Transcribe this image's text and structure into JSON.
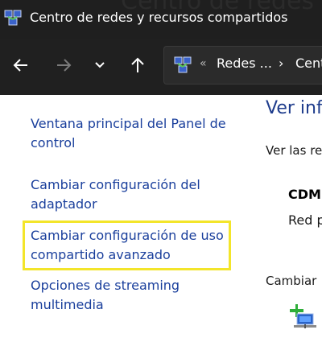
{
  "window": {
    "title": "Centro de redes y recursos compartidos",
    "background_title": "Centro de redes y"
  },
  "nav": {
    "back_icon": "arrow-left-icon",
    "forward_icon": "arrow-right-icon",
    "recent_icon": "chevron-down-icon",
    "up_icon": "arrow-up-icon"
  },
  "address": {
    "overflow": "«",
    "crumbs": [
      "Redes ...",
      "Cent"
    ],
    "separator": "›"
  },
  "sidebar": {
    "links": [
      "Ventana principal del Panel de control",
      "Cambiar configuración del adaptador",
      "Cambiar configuración de uso compartido avanzado",
      "Opciones de streaming multimedia"
    ]
  },
  "main": {
    "heading": "Ver info",
    "subheading": "Ver las re",
    "network_name": "CDM",
    "network_type": "Red p",
    "change_label": "Cambiar"
  },
  "colors": {
    "titlebar": "#1f1f1f",
    "link": "#1a3f9c",
    "highlight": "#f3e52a"
  }
}
